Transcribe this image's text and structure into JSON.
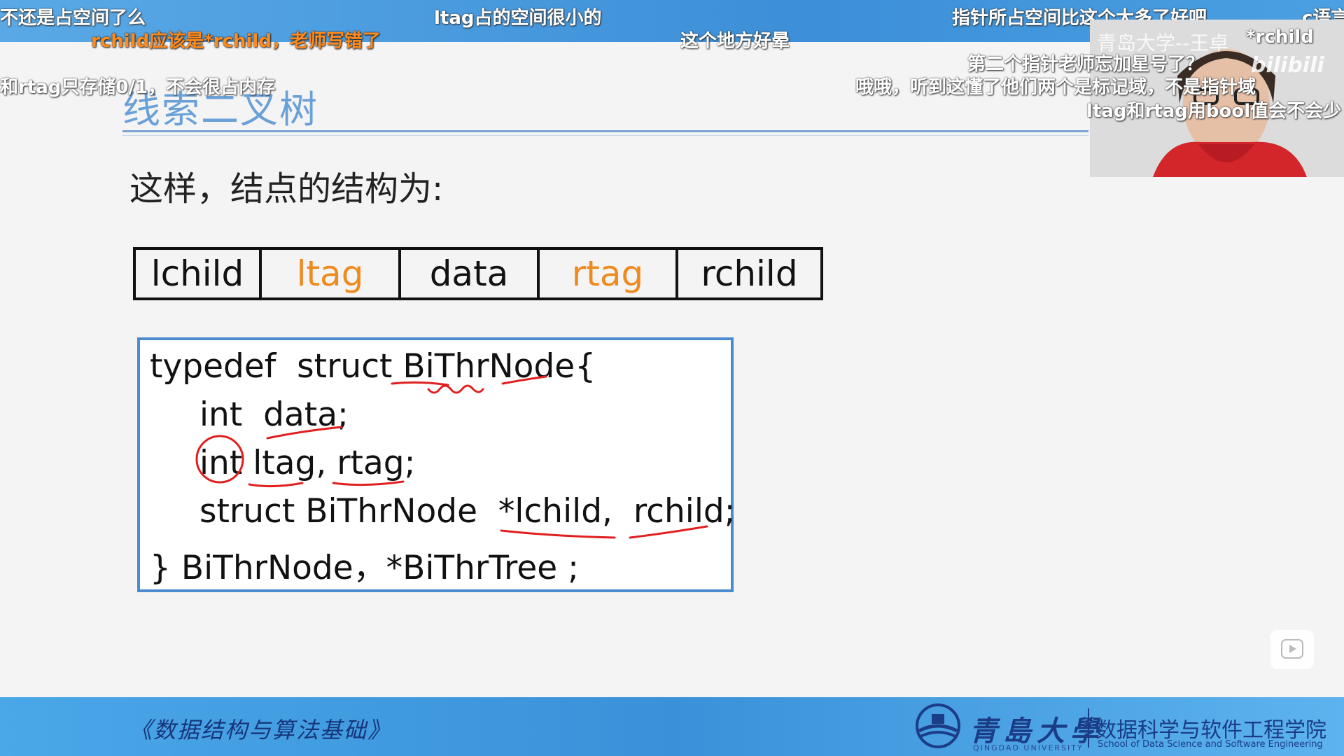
{
  "slide": {
    "title": "线索二叉树",
    "intro": "这样，结点的结构为:",
    "node_fields": [
      {
        "label": "lchild",
        "highlight": false
      },
      {
        "label": "ltag",
        "highlight": true
      },
      {
        "label": "data",
        "highlight": false
      },
      {
        "label": "rtag",
        "highlight": true
      },
      {
        "label": "rchild",
        "highlight": false
      }
    ],
    "code_lines": [
      "typedef  struct BiThrNode{",
      "int  data;",
      "int ltag, rtag;",
      "struct BiThrNode  *lchild,  rchild;",
      "} BiThrNode，*BiThrTree ;"
    ],
    "colors": {
      "tag_highlight": "#ef8a1f",
      "code_border": "#4a8ad1",
      "annotation": "#e02020"
    }
  },
  "danmaku": [
    "不还是占空间了么",
    "ltag占的空间很小的",
    "指针所占空间比这个大多了好吧",
    "c语言",
    "rchild应该是*rchild，老师写错了",
    "这个地方好晕",
    "青岛大学--王卓",
    "*rchild",
    "第二个指针老师忘加星号了？",
    "和rtag只存储0/1，不会很占内存",
    "哦哦，听到这懂了他们两个是标记域，不是指针域",
    "ltag和rtag用bool值会不会少"
  ],
  "webcam": {
    "logo": "bilibili"
  },
  "footer": {
    "course": "《数据结构与算法基础》",
    "university_cn": "青島大學",
    "university_en": "QINGDAO UNIVERSITY",
    "school_cn": "数据科学与软件工程学院",
    "school_en": "School of Data Science and Software Engineering"
  }
}
